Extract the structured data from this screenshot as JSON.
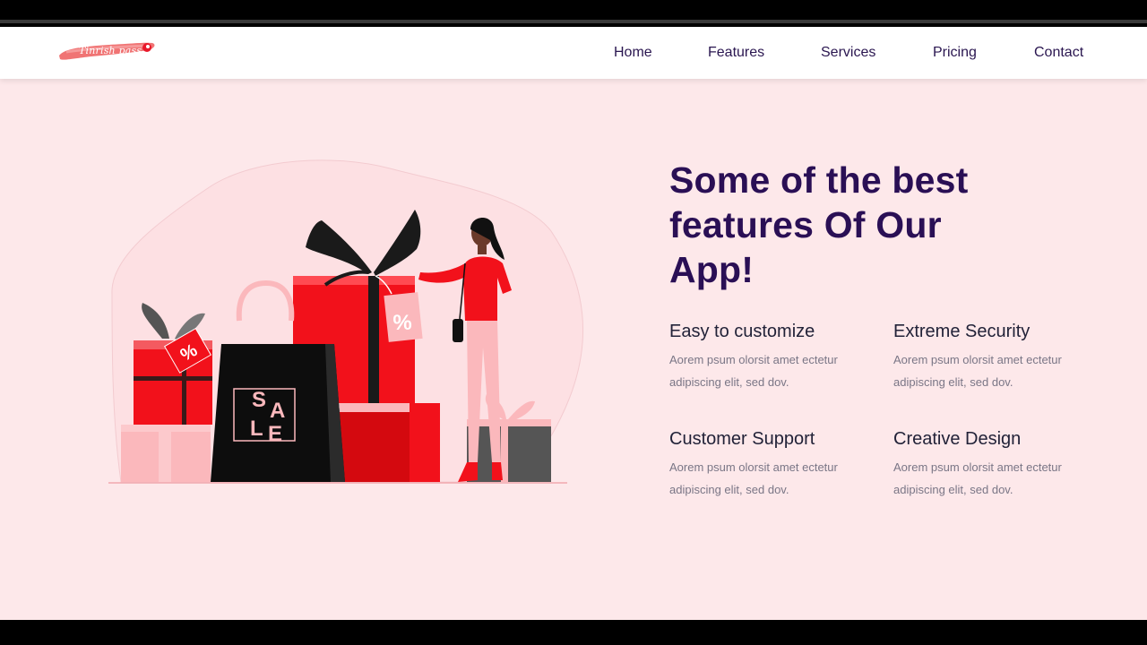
{
  "logo": {
    "text": "Tinrish pass",
    "icon": "brush-stroke-logo"
  },
  "nav": {
    "items": [
      {
        "label": "Home"
      },
      {
        "label": "Features"
      },
      {
        "label": "Services"
      },
      {
        "label": "Pricing"
      },
      {
        "label": "Contact"
      }
    ]
  },
  "illustration": {
    "sale_text": [
      "S",
      "A",
      "L",
      "E"
    ],
    "tag_symbol": "%"
  },
  "hero": {
    "heading": "Some of the best features Of Our App!"
  },
  "features": [
    {
      "title": "Easy to customize",
      "desc": "Aorem psum olorsit amet ectetur adipiscing elit, sed dov."
    },
    {
      "title": "Extreme Security",
      "desc": "Aorem psum olorsit amet ectetur adipiscing elit, sed dov."
    },
    {
      "title": "Customer Support",
      "desc": "Aorem psum olorsit amet ectetur adipiscing elit, sed dov."
    },
    {
      "title": "Creative Design",
      "desc": "Aorem psum olorsit amet ectetur adipiscing elit, sed dov."
    }
  ],
  "colors": {
    "page_bg": "#fde8ea",
    "heading": "#2a0f55",
    "nav_text": "#2a1650",
    "accent_red": "#f2111b",
    "logo_pink": "#f07474"
  }
}
